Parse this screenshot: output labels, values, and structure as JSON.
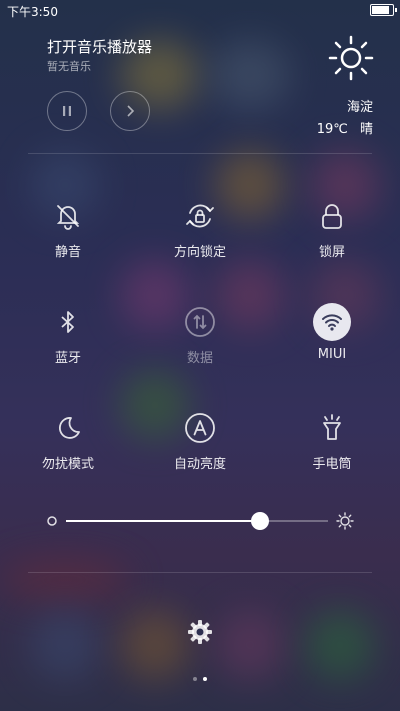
{
  "status": {
    "time": "下午3:50",
    "battery_level": 0.92
  },
  "music": {
    "title": "打开音乐播放器",
    "subtitle": "暂无音乐"
  },
  "weather": {
    "city": "海淀",
    "temp": "19℃",
    "condition": "晴",
    "icon": "sun-icon"
  },
  "tiles": [
    {
      "label": "静音",
      "icon": "bell-off-icon",
      "active": false
    },
    {
      "label": "方向锁定",
      "icon": "rotation-lock-icon",
      "active": false
    },
    {
      "label": "锁屏",
      "icon": "lock-icon",
      "active": false
    },
    {
      "label": "蓝牙",
      "icon": "bluetooth-icon",
      "active": false
    },
    {
      "label": "数据",
      "icon": "mobile-data-icon",
      "active": false,
      "dimmed": true
    },
    {
      "label": "MIUI",
      "icon": "wifi-icon",
      "active": true
    },
    {
      "label": "勿扰模式",
      "icon": "moon-icon",
      "active": false
    },
    {
      "label": "自动亮度",
      "icon": "auto-brightness-icon",
      "active": false
    },
    {
      "label": "手电筒",
      "icon": "flashlight-icon",
      "active": false
    }
  ],
  "brightness": {
    "value": 0.74
  },
  "pager": {
    "count": 2,
    "current": 1
  },
  "colors": {
    "active_tile_bg": "#e8e8ef",
    "active_icon": "#3a3d5c"
  }
}
